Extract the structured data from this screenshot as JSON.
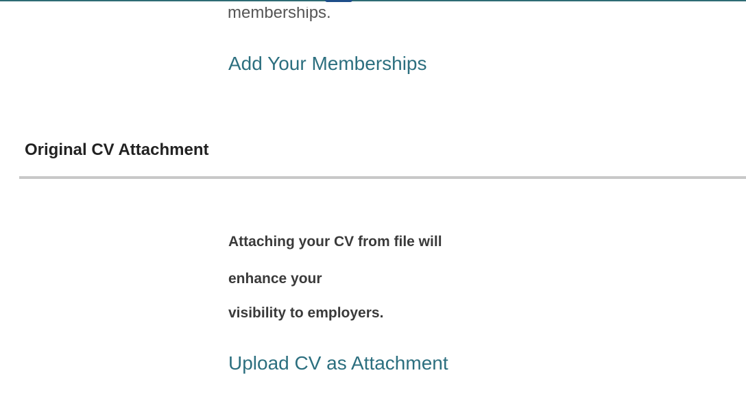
{
  "memberships_section": {
    "truncated_text": "memberships.",
    "add_link_label": "Add Your Memberships"
  },
  "cv_attachment_section": {
    "title": "Original CV Attachment",
    "description_lines": [
      "Attaching your CV from file will",
      "enhance your",
      "visibility to employers."
    ],
    "upload_link_label": "Upload CV as Attachment"
  },
  "colors": {
    "link": "#2c6f7f",
    "header_bar": "#2e6b74",
    "divider": "#c8c8c8"
  }
}
